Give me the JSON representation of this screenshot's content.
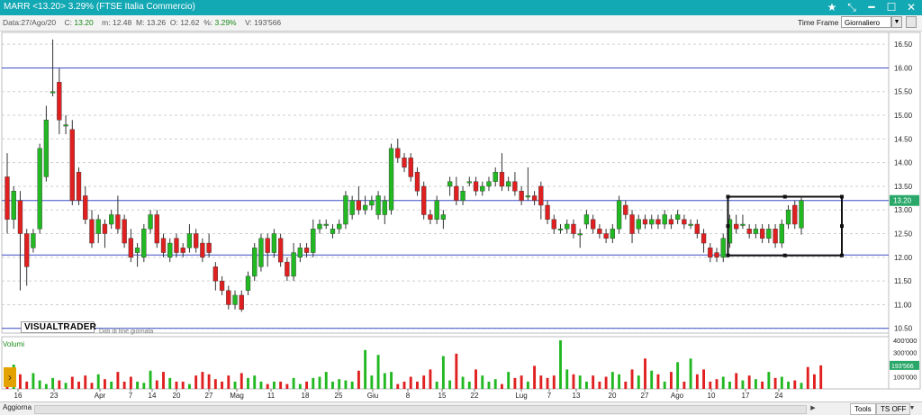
{
  "window": {
    "title": "MARR <13.20> 3.29%  (FTSE Italia Commercio)",
    "icons": [
      "star-icon",
      "minimize-icon",
      "resize-icon",
      "maximize-icon",
      "close-icon"
    ]
  },
  "info": {
    "date_label": "Data:",
    "date_value": "27/Ago/20",
    "close_label": "C:",
    "close_value": "13.20",
    "min_label": "m:",
    "min_value": "12.48",
    "max_label": "M:",
    "max_value": "13.26",
    "open_label": "O:",
    "open_value": "12.62",
    "pct_label": "%:",
    "pct_value": "3.29%",
    "vol_label": "V:",
    "vol_value": "193'566",
    "timeframe_label": "Time Frame",
    "timeframe_value": "Giornaliero"
  },
  "branding": {
    "logo": "VISUALTRADER",
    "note": "Dati di fine giornata",
    "volume_label": "Volumi"
  },
  "bottombar": {
    "aggiorna": "Aggiorna",
    "tools": "Tools",
    "tsoff": "TS OFF"
  },
  "colors": {
    "up": "#22b822",
    "down": "#e02020",
    "hline": "#3d4fc6",
    "price_tag": "#2aa86a",
    "titlebar": "#12a8b4"
  },
  "chart_data": {
    "type": "candlestick",
    "price_axis": {
      "ticks": [
        "16.50",
        "16.00",
        "15.50",
        "15.00",
        "14.50",
        "14.00",
        "13.50",
        "13.00",
        "12.50",
        "12.00",
        "11.50",
        "11.00",
        "10.50"
      ],
      "range": [
        10.4,
        16.75
      ],
      "current_tag": "13.20"
    },
    "volume_axis": {
      "ticks": [
        "400'000",
        "300'000",
        "100'000"
      ],
      "current_tag": "193'566"
    },
    "x_labels": [
      "16",
      "23",
      "Apr",
      "7",
      "14",
      "20",
      "27",
      "Mag",
      "11",
      "18",
      "25",
      "Giu",
      "8",
      "15",
      "22",
      "Lug",
      "7",
      "13",
      "20",
      "27",
      "Ago",
      "10",
      "17",
      "24"
    ],
    "horizontal_lines": [
      16.0,
      13.2,
      12.05,
      10.5
    ],
    "range_box": {
      "top": 13.28,
      "bottom": 12.04
    },
    "ohlc": [
      [
        13.7,
        12.8,
        14.2,
        12.5
      ],
      [
        12.8,
        13.4,
        13.5,
        12.6
      ],
      [
        13.2,
        12.5,
        13.4,
        11.3
      ],
      [
        12.5,
        11.8,
        12.6,
        11.4
      ],
      [
        12.2,
        12.5,
        12.6,
        12.1
      ],
      [
        12.6,
        14.3,
        14.4,
        12.5
      ],
      [
        13.7,
        14.9,
        15.2,
        13.6
      ],
      [
        15.5,
        15.5,
        16.6,
        15.4
      ],
      [
        15.7,
        14.9,
        16.0,
        14.6
      ],
      [
        14.8,
        14.8,
        15.0,
        14.6
      ],
      [
        14.7,
        13.2,
        14.9,
        13.1
      ],
      [
        13.8,
        13.2,
        13.9,
        13.1
      ],
      [
        13.3,
        12.8,
        13.5,
        12.7
      ],
      [
        12.8,
        12.3,
        13.0,
        12.2
      ],
      [
        12.5,
        12.8,
        12.9,
        12.3
      ],
      [
        12.7,
        12.5,
        12.8,
        12.2
      ],
      [
        12.7,
        12.9,
        13.0,
        12.6
      ],
      [
        12.9,
        12.6,
        13.3,
        12.5
      ],
      [
        12.8,
        12.3,
        12.9,
        12.2
      ],
      [
        12.4,
        12.0,
        12.6,
        11.9
      ],
      [
        12.1,
        12.2,
        12.3,
        11.8
      ],
      [
        12.0,
        12.6,
        12.7,
        11.9
      ],
      [
        12.6,
        12.9,
        13.0,
        12.5
      ],
      [
        12.9,
        12.3,
        13.0,
        12.2
      ],
      [
        12.4,
        12.1,
        12.5,
        12.0
      ],
      [
        12.0,
        12.3,
        12.4,
        11.9
      ],
      [
        12.4,
        12.1,
        12.5,
        12.0
      ],
      [
        12.2,
        12.1,
        12.3,
        12.0
      ],
      [
        12.2,
        12.5,
        12.7,
        12.1
      ],
      [
        12.5,
        12.2,
        12.6,
        12.1
      ],
      [
        12.3,
        12.0,
        12.4,
        11.9
      ],
      [
        12.3,
        12.1,
        12.5,
        12.0
      ],
      [
        11.8,
        11.5,
        11.9,
        11.3
      ],
      [
        11.5,
        11.3,
        11.6,
        11.2
      ],
      [
        11.3,
        11.0,
        11.4,
        10.9
      ],
      [
        11.0,
        11.2,
        11.3,
        10.9
      ],
      [
        11.2,
        10.9,
        11.3,
        10.85
      ],
      [
        11.3,
        11.6,
        11.7,
        11.2
      ],
      [
        11.6,
        12.2,
        12.3,
        11.5
      ],
      [
        11.8,
        12.4,
        12.5,
        11.7
      ],
      [
        12.4,
        12.1,
        12.5,
        11.8
      ],
      [
        12.1,
        12.5,
        12.6,
        12.0
      ],
      [
        12.4,
        11.9,
        12.5,
        11.8
      ],
      [
        11.9,
        11.6,
        12.0,
        11.5
      ],
      [
        11.6,
        12.1,
        12.3,
        11.5
      ],
      [
        12.0,
        12.2,
        12.3,
        11.9
      ],
      [
        12.2,
        12.1,
        12.3,
        12.0
      ],
      [
        12.1,
        12.6,
        12.8,
        12.0
      ],
      [
        12.6,
        12.7,
        12.8,
        12.5
      ],
      [
        12.7,
        12.7,
        12.8,
        12.6
      ],
      [
        12.5,
        12.6,
        12.7,
        12.4
      ],
      [
        12.6,
        12.7,
        12.8,
        12.5
      ],
      [
        12.7,
        13.3,
        13.4,
        12.6
      ],
      [
        12.9,
        13.2,
        13.3,
        12.8
      ],
      [
        13.2,
        13.0,
        13.5,
        12.9
      ],
      [
        13.0,
        13.1,
        13.3,
        12.9
      ],
      [
        13.1,
        13.2,
        13.3,
        13.0
      ],
      [
        12.9,
        13.3,
        13.4,
        12.8
      ],
      [
        12.9,
        13.2,
        13.3,
        12.7
      ],
      [
        13.0,
        14.3,
        14.4,
        12.9
      ],
      [
        14.3,
        14.1,
        14.5,
        14.0
      ],
      [
        14.1,
        13.9,
        14.2,
        13.8
      ],
      [
        14.1,
        13.7,
        14.2,
        13.6
      ],
      [
        13.8,
        13.4,
        13.9,
        13.3
      ],
      [
        13.5,
        12.9,
        13.6,
        12.8
      ],
      [
        12.9,
        12.8,
        13.0,
        12.7
      ],
      [
        12.8,
        13.2,
        13.3,
        12.7
      ],
      [
        12.8,
        12.9,
        13.0,
        12.6
      ],
      [
        13.5,
        13.6,
        13.7,
        13.3
      ],
      [
        13.5,
        13.2,
        13.7,
        13.1
      ],
      [
        13.2,
        13.4,
        13.5,
        13.1
      ],
      [
        13.6,
        13.6,
        13.7,
        13.5
      ],
      [
        13.6,
        13.4,
        13.7,
        13.3
      ],
      [
        13.4,
        13.5,
        13.6,
        13.3
      ],
      [
        13.5,
        13.6,
        13.7,
        13.4
      ],
      [
        13.6,
        13.8,
        13.9,
        13.5
      ],
      [
        13.8,
        13.5,
        14.2,
        13.4
      ],
      [
        13.5,
        13.6,
        13.7,
        13.4
      ],
      [
        13.6,
        13.4,
        13.8,
        13.3
      ],
      [
        13.4,
        13.2,
        13.5,
        13.1
      ],
      [
        13.3,
        13.3,
        13.9,
        13.2
      ],
      [
        13.3,
        13.2,
        13.4,
        13.1
      ],
      [
        13.5,
        13.1,
        13.6,
        12.8
      ],
      [
        13.1,
        12.8,
        13.2,
        12.7
      ],
      [
        12.8,
        12.6,
        12.9,
        12.5
      ],
      [
        12.6,
        12.6,
        12.7,
        12.5
      ],
      [
        12.6,
        12.7,
        12.8,
        12.5
      ],
      [
        12.7,
        12.5,
        12.8,
        12.4
      ],
      [
        12.5,
        12.5,
        12.6,
        12.2
      ],
      [
        12.7,
        12.9,
        13.0,
        12.6
      ],
      [
        12.8,
        12.6,
        12.9,
        12.5
      ],
      [
        12.6,
        12.5,
        12.7,
        12.4
      ],
      [
        12.5,
        12.4,
        12.6,
        12.3
      ],
      [
        12.4,
        12.6,
        12.7,
        12.3
      ],
      [
        12.6,
        13.2,
        13.3,
        12.5
      ],
      [
        13.1,
        12.9,
        13.2,
        12.8
      ],
      [
        12.9,
        12.5,
        13.0,
        12.3
      ],
      [
        12.6,
        12.8,
        12.9,
        12.5
      ],
      [
        12.8,
        12.7,
        12.9,
        12.6
      ],
      [
        12.7,
        12.8,
        12.9,
        12.6
      ],
      [
        12.8,
        12.7,
        12.9,
        12.6
      ],
      [
        12.7,
        12.9,
        13.0,
        12.6
      ],
      [
        12.8,
        12.7,
        12.9,
        12.6
      ],
      [
        12.8,
        12.9,
        13.0,
        12.7
      ],
      [
        12.8,
        12.7,
        12.9,
        12.6
      ],
      [
        12.7,
        12.7,
        12.8,
        12.6
      ],
      [
        12.7,
        12.5,
        12.8,
        12.4
      ],
      [
        12.5,
        12.3,
        12.6,
        12.1
      ],
      [
        12.2,
        12.0,
        12.3,
        11.9
      ],
      [
        12.1,
        12.0,
        12.2,
        11.9
      ],
      [
        12.0,
        12.4,
        12.5,
        11.9
      ],
      [
        12.3,
        12.8,
        12.9,
        12.2
      ],
      [
        12.7,
        12.6,
        12.9,
        12.5
      ],
      [
        12.7,
        12.7,
        12.9,
        12.6
      ],
      [
        12.6,
        12.5,
        12.7,
        12.4
      ],
      [
        12.5,
        12.6,
        12.7,
        12.4
      ],
      [
        12.6,
        12.4,
        12.7,
        12.3
      ],
      [
        12.4,
        12.6,
        12.7,
        12.3
      ],
      [
        12.6,
        12.3,
        12.7,
        12.2
      ],
      [
        12.3,
        12.7,
        12.8,
        12.2
      ],
      [
        12.7,
        13.0,
        13.1,
        12.6
      ],
      [
        13.1,
        12.7,
        13.2,
        12.6
      ],
      [
        12.62,
        13.2,
        13.26,
        12.48
      ]
    ],
    "volumes": [
      140000,
      200000,
      120000,
      60000,
      130000,
      70000,
      40000,
      90000,
      70000,
      50000,
      100000,
      60000,
      110000,
      50000,
      120000,
      80000,
      60000,
      140000,
      60000,
      100000,
      60000,
      50000,
      150000,
      70000,
      140000,
      90000,
      60000,
      60000,
      40000,
      110000,
      140000,
      120000,
      80000,
      60000,
      110000,
      60000,
      130000,
      90000,
      110000,
      60000,
      40000,
      60000,
      60000,
      40000,
      90000,
      40000,
      60000,
      90000,
      100000,
      140000,
      60000,
      80000,
      70000,
      60000,
      150000,
      320000,
      110000,
      280000,
      130000,
      140000,
      40000,
      60000,
      100000,
      60000,
      110000,
      160000,
      60000,
      270000,
      70000,
      290000,
      100000,
      60000,
      160000,
      110000,
      60000,
      80000,
      40000,
      140000,
      90000,
      110000,
      60000,
      190000,
      110000,
      90000,
      110000,
      400000,
      160000,
      120000,
      110000,
      60000,
      110000,
      60000,
      100000,
      140000,
      120000,
      60000,
      160000,
      110000,
      250000,
      150000,
      120000,
      60000,
      140000,
      220000,
      60000,
      250000,
      120000,
      160000,
      60000,
      80000,
      100000,
      60000,
      130000,
      70000,
      110000,
      80000,
      60000,
      140000,
      90000,
      100000,
      60000,
      70000,
      50000,
      180000,
      120000,
      193566
    ]
  }
}
